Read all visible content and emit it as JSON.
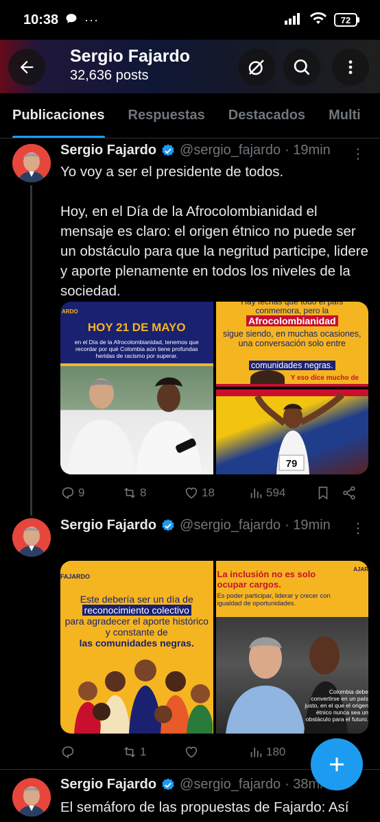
{
  "status_bar": {
    "time": "10:38",
    "battery": "72"
  },
  "profile": {
    "name": "Sergio Fajardo",
    "posts": "32,636 posts"
  },
  "tabs": [
    {
      "label": "Publicaciones",
      "active": true
    },
    {
      "label": "Respuestas",
      "active": false
    },
    {
      "label": "Destacados",
      "active": false
    },
    {
      "label": "Multi",
      "active": false
    }
  ],
  "tweets": [
    {
      "name": "Sergio Fajardo",
      "handle": "@sergio_fajardo",
      "time": "· 19min",
      "text_line1": "Yo voy a ser el presidente de todos.",
      "text_line2": "Hoy, en el Día de la Afrocolombianidad el mensaje es claro: el origen étnico no puede ser un obstáculo para que la negritud participe, lidere y aporte plenamente en todos los niveles de la sociedad.",
      "media": {
        "img1_title": "HOY 21 DE MAYO",
        "img1_brand": "ARDO",
        "img1_text": "en el Día de la Afrocolombianidad, tenemos que recordar por qué Colombia aún tiene profundas heridas de racismo por superar.",
        "img2_line1": "Hay fechas que todo el país conmemora, pero la",
        "img2_highlight": "Afrocolombianidad",
        "img2_line2": "sigue siendo, en muchas ocasiones, una conversación solo entre",
        "img2_line3": "comunidades negras.",
        "img2_footer": "Y eso dice mucho de",
        "img3_bib": "79"
      },
      "replies": "9",
      "reposts": "8",
      "likes": "18",
      "views": "594"
    },
    {
      "name": "Sergio Fajardo",
      "handle": "@sergio_fajardo",
      "time": "· 19min",
      "media": {
        "img1_brand": "FAJARDO",
        "img1_text1": "Este debería ser un día de",
        "img1_highlight": "reconocimiento colectivo",
        "img1_text2": "para agradecer el aporte histórico y constante de",
        "img1_highlight2": "las comunidades negras.",
        "img2_title": "La inclusión no es solo ocupar cargos.",
        "img2_brand": "AJAR",
        "img2_text": "Es poder participar, liderar y crecer con igualdad de oportunidades.",
        "img2_footer1": "Colombia debe",
        "img2_footer2": "convertirse en un país",
        "img2_footer3": "justo, en el que el origen",
        "img2_footer4": "étnico nunca sea un",
        "img2_footer5": "obstáculo para el futuro."
      },
      "replies": "",
      "reposts": "1",
      "likes": "",
      "views": "180"
    },
    {
      "name": "Sergio Fajardo",
      "handle": "@sergio_fajardo",
      "time": "· 38mi",
      "text_line1": "El semáforo de las propuestas de Fajardo: Así"
    }
  ],
  "colors": {
    "accent": "#1d9bf0",
    "background": "#000000",
    "muted": "#71767b"
  }
}
